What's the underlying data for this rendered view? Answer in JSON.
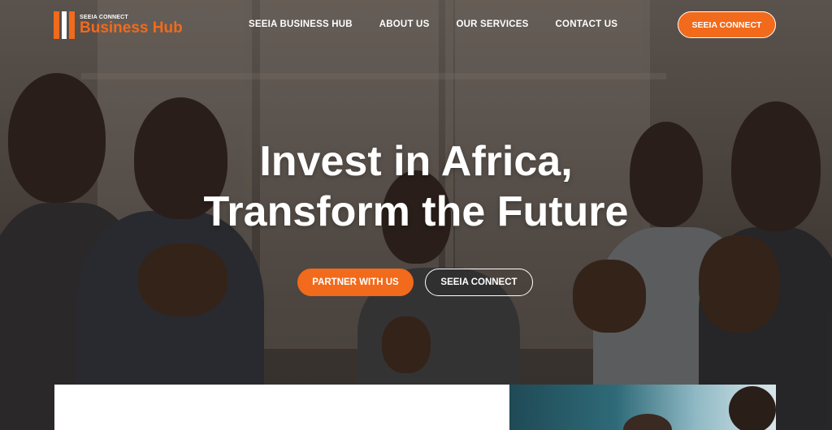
{
  "brand": {
    "small_text": "SEEIA CONNECT",
    "name": "Business Hub",
    "accent_color": "#f26a1b"
  },
  "nav": {
    "items": [
      {
        "label": "SEEIA BUSINESS HUB"
      },
      {
        "label": "ABOUT US"
      },
      {
        "label": "OUR SERVICES"
      },
      {
        "label": "CONTACT US"
      }
    ],
    "cta_label": "SEEIA CONNECT"
  },
  "hero": {
    "headline_line1": "Invest in Africa,",
    "headline_line2": "Transform the Future",
    "primary_button": "PARTNER WITH US",
    "secondary_button": "SEEIA CONNECT"
  }
}
